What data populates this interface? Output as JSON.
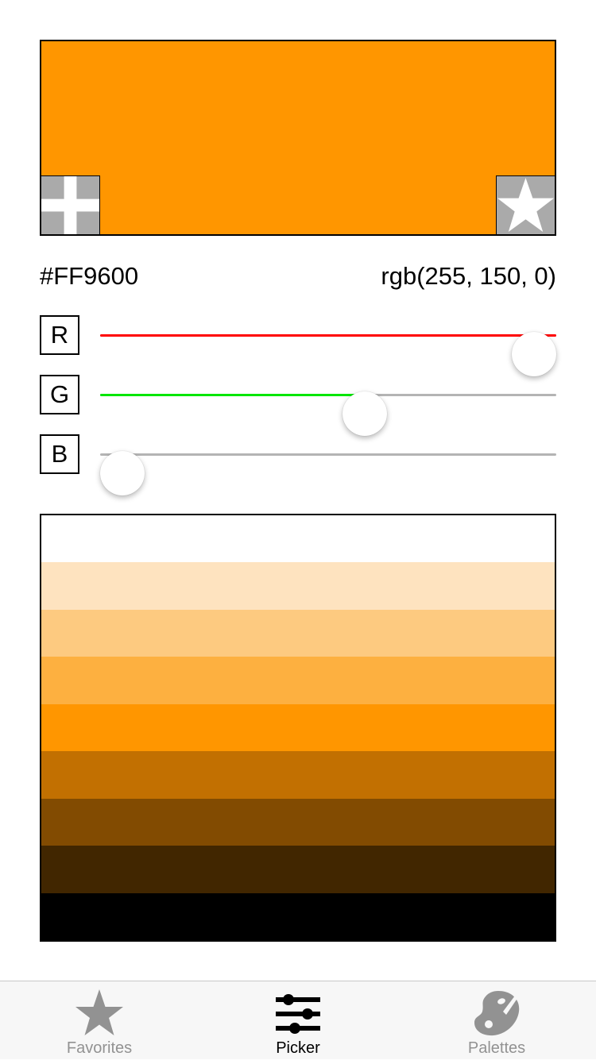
{
  "color": {
    "hex": "#FF9600",
    "rgb_text": "rgb(255, 150, 0)",
    "r": 255,
    "g": 150,
    "b": 0
  },
  "preview": {
    "add_button_icon": "plus-icon",
    "favorite_button_icon": "star-icon",
    "button_color": "#aaaaaa"
  },
  "sliders": [
    {
      "label": "R",
      "value": 255,
      "max": 255,
      "fill_color": "#ff0000"
    },
    {
      "label": "G",
      "value": 150,
      "max": 255,
      "fill_color": "#00e600"
    },
    {
      "label": "B",
      "value": 0,
      "max": 255,
      "fill_color": "#0000ff"
    }
  ],
  "track_color": "#b4b4b4",
  "shades": [
    "#ffffff",
    "#fee3bf",
    "#fdca80",
    "#fdb040",
    "#ff9600",
    "#c27001",
    "#824b01",
    "#412600",
    "#000000"
  ],
  "tabbar": {
    "tabs": [
      {
        "label": "Favorites",
        "icon": "star-icon",
        "active": false
      },
      {
        "label": "Picker",
        "icon": "sliders-icon",
        "active": true
      },
      {
        "label": "Palettes",
        "icon": "palette-icon",
        "active": false
      }
    ],
    "active_color": "#000000",
    "inactive_color": "#929292"
  }
}
